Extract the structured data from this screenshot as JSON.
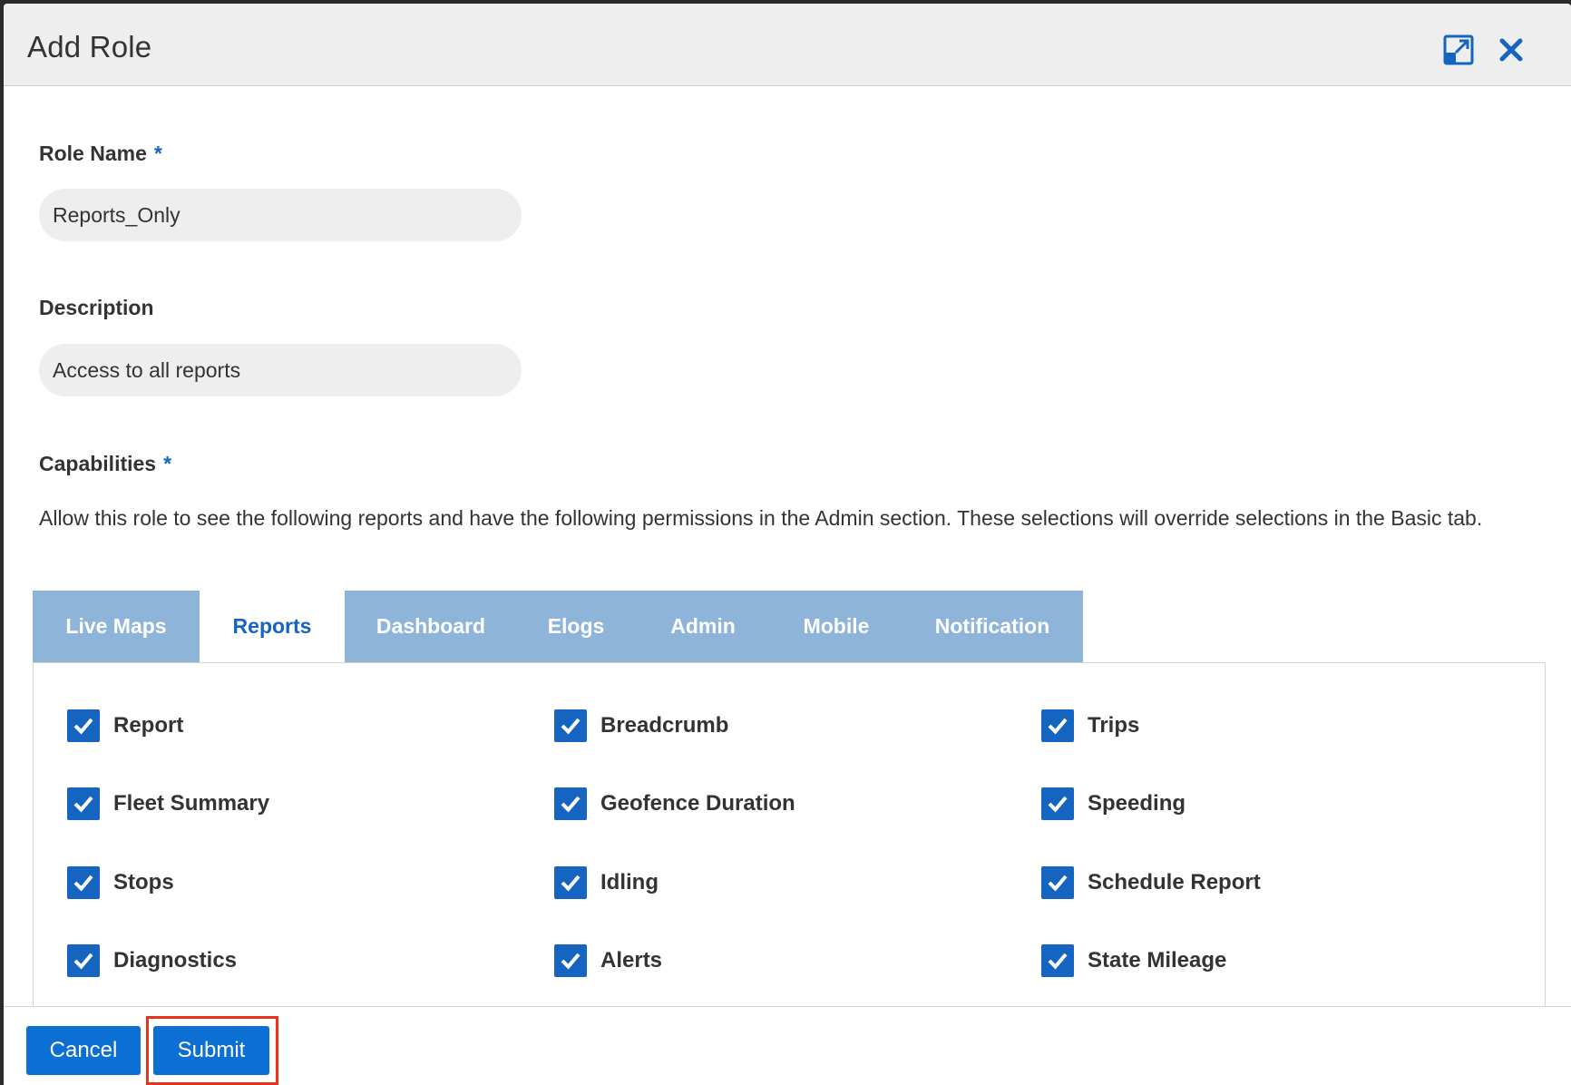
{
  "dialog": {
    "title": "Add Role"
  },
  "header_icons": [
    "popout-icon",
    "close-icon"
  ],
  "form": {
    "role_name": {
      "label": "Role Name",
      "required_mark": "*",
      "value": "Reports_Only"
    },
    "description": {
      "label": "Description",
      "value": "Access to all reports"
    },
    "capabilities": {
      "label": "Capabilities",
      "required_mark": "*",
      "help_text": "Allow this role to see the following reports and have the following permissions in the Admin section. These selections will override selections in the Basic tab."
    }
  },
  "tabs": [
    {
      "label": "Live Maps",
      "active": false
    },
    {
      "label": "Reports",
      "active": true
    },
    {
      "label": "Dashboard",
      "active": false
    },
    {
      "label": "Elogs",
      "active": false
    },
    {
      "label": "Admin",
      "active": false
    },
    {
      "label": "Mobile",
      "active": false
    },
    {
      "label": "Notification",
      "active": false
    }
  ],
  "capabilities_items": [
    {
      "label": "Report",
      "checked": true
    },
    {
      "label": "Breadcrumb",
      "checked": true
    },
    {
      "label": "Trips",
      "checked": true
    },
    {
      "label": "Fleet Summary",
      "checked": true
    },
    {
      "label": "Geofence Duration",
      "checked": true
    },
    {
      "label": "Speeding",
      "checked": true
    },
    {
      "label": "Stops",
      "checked": true
    },
    {
      "label": "Idling",
      "checked": true
    },
    {
      "label": "Schedule Report",
      "checked": true
    },
    {
      "label": "Diagnostics",
      "checked": true
    },
    {
      "label": "Alerts",
      "checked": true
    },
    {
      "label": "State Mileage",
      "checked": true
    }
  ],
  "footer": {
    "cancel_label": "Cancel",
    "submit_label": "Submit"
  },
  "colors": {
    "accent": "#1565c0",
    "button": "#0b6fd4",
    "tab_inactive": "#8fb4d9",
    "highlight": "#e8321c"
  }
}
